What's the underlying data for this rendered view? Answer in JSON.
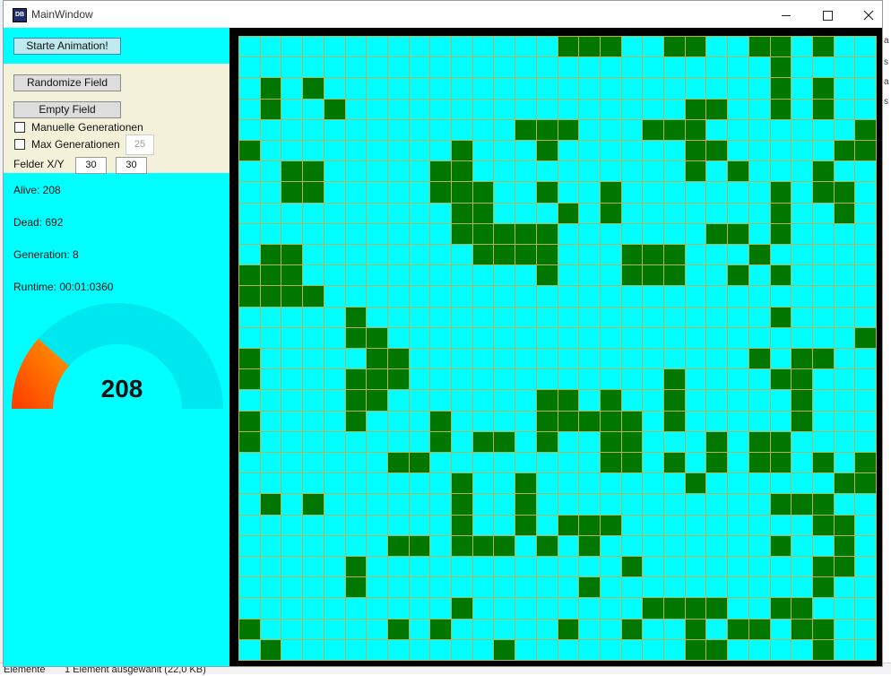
{
  "window": {
    "title": "MainWindow",
    "icon_label": "DB",
    "controls": {
      "minimize": "minimize",
      "maximize": "maximize",
      "close": "close"
    }
  },
  "background": {
    "right_peek": [
      "a",
      "s",
      "a",
      "s"
    ],
    "status": [
      "Elemente",
      "1 Element ausgewählt (22,0 KB)"
    ]
  },
  "controls": {
    "start_label": "Starte Animation!",
    "randomize_label": "Randomize Field",
    "empty_label": "Empty Field",
    "manual_label": "Manuelle Generationen",
    "manual_checked": false,
    "max_label": "Max Generationen",
    "max_checked": false,
    "max_value": "25",
    "felder_label": "Felder X/Y",
    "felder_x": "30",
    "felder_y": "30"
  },
  "stats": {
    "alive": "Alive: 208",
    "dead": "Dead: 692",
    "generation": "Generation: 8",
    "runtime": "Runtime: 00:01:0360"
  },
  "gauge": {
    "value": "208",
    "fraction": 0.231,
    "track_color": "#00e8ef",
    "fill_start": "#ff3a00",
    "fill_end": "#ff9a00"
  },
  "board": {
    "cols": 30,
    "rows": 30,
    "alive_color": "#007800",
    "dead_color": "#00ffff",
    "grid_line_color": "#b5b35a",
    "cells": [
      "000000000000000111001100110100",
      "000000000000000000000000010000",
      "010100000000000000000000010100",
      "010010000000000000000110010100",
      "000000000000011100011100000001",
      "100000000010001000000110000011",
      "001100000110000000000101000100",
      "001100000111001001000000010110",
      "000000000011000101000000010010",
      "000000000011111000000011010000",
      "011000000001111000111000100000",
      "111000000000001000111001010000",
      "111100000000000000000000000000",
      "000001000000000000000000010000",
      "000001100000000000000000000001",
      "100000110000000000000000101100",
      "100001110000000000001000011000",
      "000001100000001101001000001000",
      "100001000100001111101000001000",
      "100000000101101001100010110000",
      "000000011000000001101010110101",
      "000000000010010000000100000011",
      "010100000010010000000000011100",
      "000000000010010111000000000110",
      "000000011011101010000000010010",
      "000001000000000000100000000110",
      "000001000000000010000000000100",
      "000000000010000000011110011000",
      "100000010100000100100101101100",
      "010000000000100000000110000100"
    ]
  }
}
